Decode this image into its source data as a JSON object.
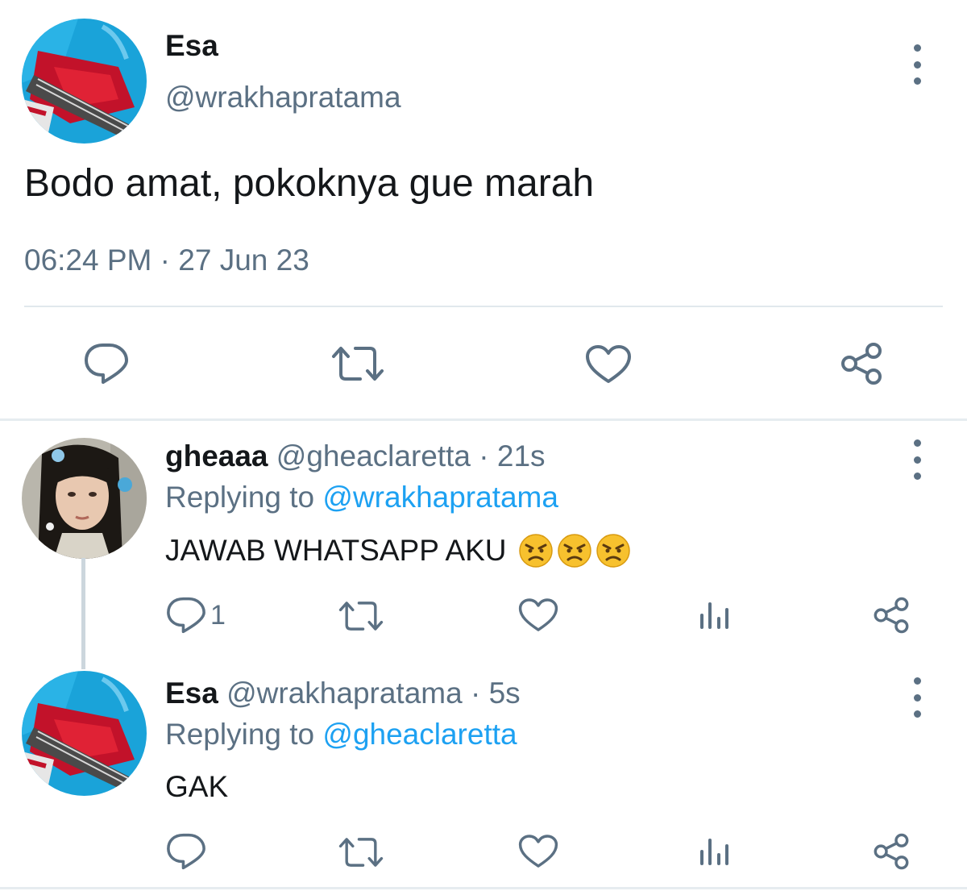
{
  "main_tweet": {
    "name": "Esa",
    "handle": "@wrakhapratama",
    "text": "Bodo amat, pokoknya gue marah",
    "time": "06:24 PM",
    "separator": "·",
    "date": "27 Jun 23"
  },
  "replies": [
    {
      "name": "gheaaa",
      "handle": "@gheaclaretta",
      "separator": "·",
      "age": "21s",
      "replying_label": "Replying to",
      "replying_handle": "@wrakhapratama",
      "text": "JAWAB WHATSAPP AKU",
      "emojis": [
        "angry-face",
        "angry-face",
        "angry-face"
      ],
      "reply_count": "1"
    },
    {
      "name": "Esa",
      "handle": "@wrakhapratama",
      "separator": "·",
      "age": "5s",
      "replying_label": "Replying to",
      "replying_handle": "@gheaclaretta",
      "text": "GAK",
      "reply_count": ""
    }
  ],
  "icons": [
    "reply-icon",
    "retweet-icon",
    "like-icon",
    "analytics-icon",
    "share-icon",
    "more-options-icon",
    "angry-face-emoji"
  ],
  "colors": {
    "text": "#14171a",
    "secondary": "#5b7083",
    "link": "#1da1f2",
    "divider": "#e1e8ed"
  }
}
